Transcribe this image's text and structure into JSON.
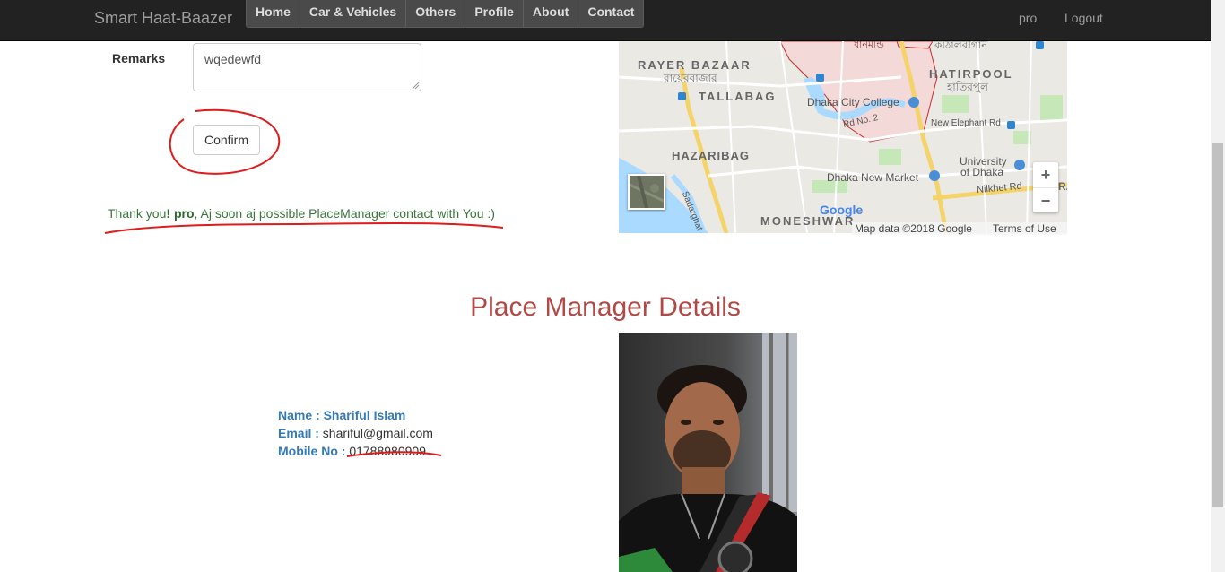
{
  "navbar": {
    "brand": "Smart Haat-Baazer",
    "items": [
      "Home",
      "Car & Vehicles",
      "Others",
      "Profile",
      "About",
      "Contact"
    ],
    "user": "pro",
    "logout": "Logout"
  },
  "form": {
    "remarks_label": "Remarks",
    "remarks_value": "wqedewfd",
    "confirm_label": "Confirm",
    "thanks_prefix": "Thank you",
    "thanks_bang": "!",
    "thanks_user": "pro",
    "thanks_suffix": ", Aj soon aj possible PlaceManager contact with You :)"
  },
  "map": {
    "labels": {
      "rayer_bazaar": "RAYER BAZAAR",
      "rayer_bazaar_bn": "রায়েরবাজার",
      "tallabag": "TALLABAG",
      "hazaribag": "HAZARIBAG",
      "hatirpool": "HATIRPOOL",
      "hatirpool_bn": "হাতিরপুল",
      "kathalbagan_bn": "কাঠালবাগান",
      "dhanmondi_bn": "ধানমন্ডি",
      "dhaka_city_college": "Dhaka City College",
      "rd_no_2": "Rd No. 2",
      "new_elephant_rd": "New Elephant Rd",
      "university_of_dhaka_1": "University",
      "university_of_dhaka_2": "of Dhaka",
      "dhaka_new_market": "Dhaka New Market",
      "nilkhet_rd": "Nilkhet Rd",
      "moneshwar": "MONESHWAR",
      "sadarghat": "Sadarghat - Gab",
      "google": "Google",
      "ra": "RA"
    },
    "zoom_in": "+",
    "zoom_out": "−",
    "map_data": "Map data ©2018 Google",
    "terms": "Terms of Use"
  },
  "details": {
    "title": "Place Manager Details",
    "name_label": "Name :",
    "name_value": "Shariful Islam",
    "email_label": "Email :",
    "email_value": "shariful@gmail.com",
    "mobile_label": "Mobile No :",
    "mobile_value": "01788980909"
  },
  "colors": {
    "navbar_bg": "#222222",
    "title_red": "#b04a48",
    "link_blue": "#337ab7",
    "success_green": "#3c763d",
    "annotation_red": "#e01b1b"
  }
}
